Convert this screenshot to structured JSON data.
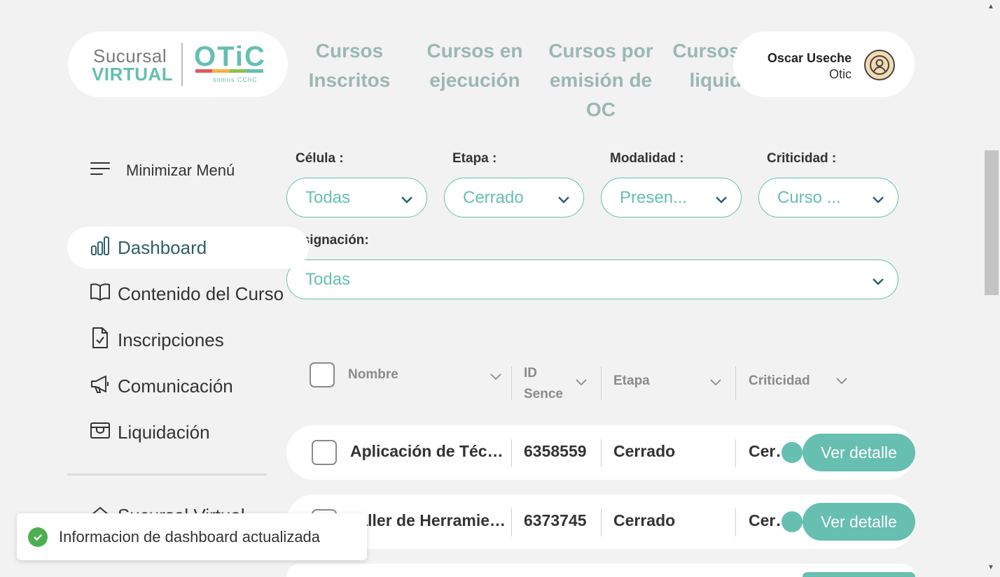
{
  "brand": {
    "line1": "Sucursal",
    "line2": "VIRTUAL",
    "otic": "OTiC",
    "tagline": "somos CChC",
    "bar_colors": [
      "#e05a5a",
      "#f2b33d",
      "#8bc34a",
      "#66bfb0"
    ]
  },
  "nav": {
    "items": [
      {
        "label": "Cursos Inscritos"
      },
      {
        "label": "Cursos en ejecución"
      },
      {
        "label": "Cursos por emisión de OC"
      },
      {
        "label": "Cursos por liquidar"
      }
    ]
  },
  "user": {
    "name": "Oscar Useche",
    "role": "Otic",
    "icon": "user-avatar-icon"
  },
  "sidebar": {
    "minimize_label": "Minimizar Menú",
    "items": [
      {
        "label": "Dashboard",
        "icon": "bar-chart-icon"
      },
      {
        "label": "Contenido del Curso",
        "icon": "book-icon"
      },
      {
        "label": "Inscripciones",
        "icon": "document-check-icon"
      },
      {
        "label": "Comunicación",
        "icon": "megaphone-icon"
      },
      {
        "label": "Liquidación",
        "icon": "wallet-icon"
      }
    ],
    "partial_item": "Sucursal Virtual"
  },
  "filters": {
    "celula": {
      "label": "Célula :",
      "value": "Todas"
    },
    "etapa": {
      "label": "Etapa :",
      "value": "Cerrado"
    },
    "modalidad": {
      "label": "Modalidad :",
      "value": "Presen..."
    },
    "criticidad": {
      "label": "Criticidad :",
      "value": "Curso ..."
    },
    "asignacion": {
      "label": "Asignación:",
      "value": "Todas"
    }
  },
  "table": {
    "headers": {
      "nombre": "Nombre",
      "id_sence": "ID Sence",
      "etapa": "Etapa",
      "criticidad": "Criticidad"
    },
    "rows": [
      {
        "nombre": "Aplicación de Técnicas",
        "id_sence": "6358559",
        "etapa": "Cerrado",
        "criticidad": "Cerrado",
        "action": "Ver detalle"
      },
      {
        "nombre": "Taller de Herramientas",
        "id_sence": "6373745",
        "etapa": "Cerrado",
        "criticidad": "Cerrado",
        "action": "Ver detalle"
      }
    ]
  },
  "toast": {
    "message": "Informacion de dashboard actualizada"
  },
  "colors": {
    "accent": "#66bfb0",
    "nav_text": "#9bb7b3"
  }
}
